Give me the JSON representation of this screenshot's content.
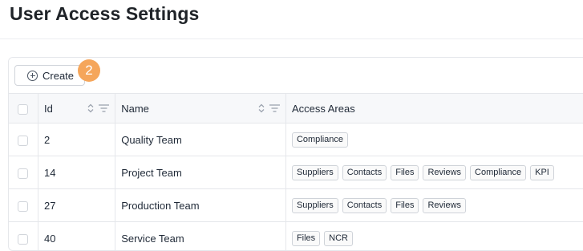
{
  "page": {
    "title": "User Access Settings"
  },
  "toolbar": {
    "create_label": "Create",
    "step_badge": "2"
  },
  "table": {
    "columns": {
      "id": "Id",
      "name": "Name",
      "access": "Access Areas"
    },
    "rows": [
      {
        "id": "2",
        "name": "Quality Team",
        "areas": [
          "Compliance"
        ]
      },
      {
        "id": "14",
        "name": "Project Team",
        "areas": [
          "Suppliers",
          "Contacts",
          "Files",
          "Reviews",
          "Compliance",
          "KPI"
        ]
      },
      {
        "id": "27",
        "name": "Production Team",
        "areas": [
          "Suppliers",
          "Contacts",
          "Files",
          "Reviews"
        ]
      },
      {
        "id": "40",
        "name": "Service Team",
        "areas": [
          "Files",
          "NCR"
        ]
      }
    ]
  },
  "colors": {
    "badge": "#f5a65b",
    "header_bg": "#f7f8fa",
    "border": "#e5e7eb"
  },
  "icons": [
    "plus-circle-icon",
    "sort-icon",
    "filter-icon"
  ]
}
